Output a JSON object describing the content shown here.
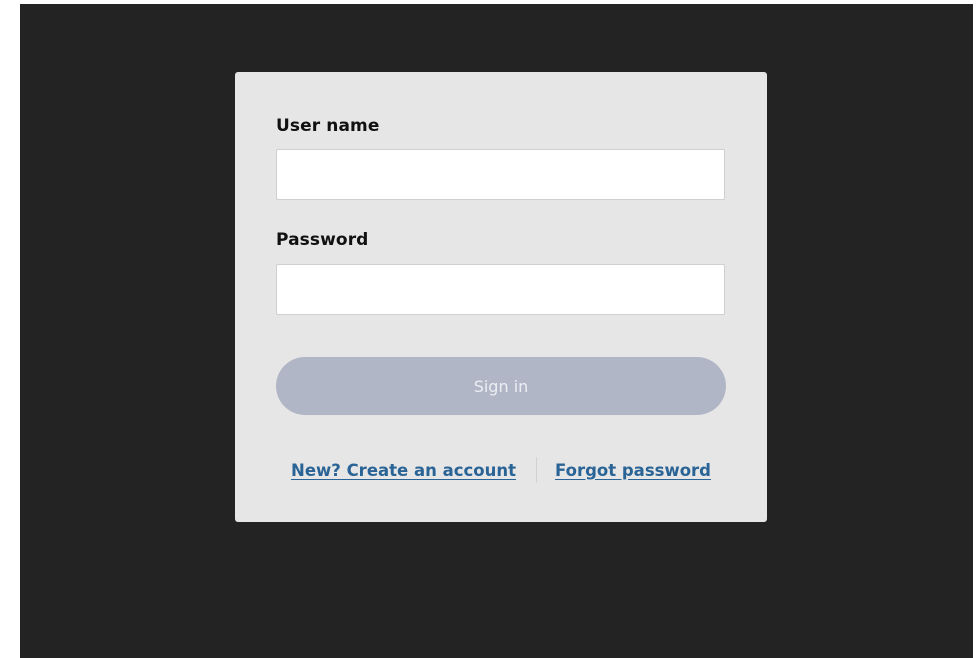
{
  "login": {
    "username_label": "User name",
    "username_value": "",
    "password_label": "Password",
    "password_value": "",
    "signin_label": "Sign in",
    "create_account_link": "New? Create an account",
    "forgot_password_link": "Forgot password"
  },
  "colors": {
    "background": "#232323",
    "card": "#e6e6e6",
    "button_disabled": "#b1b6c6",
    "link": "#2a6496"
  }
}
